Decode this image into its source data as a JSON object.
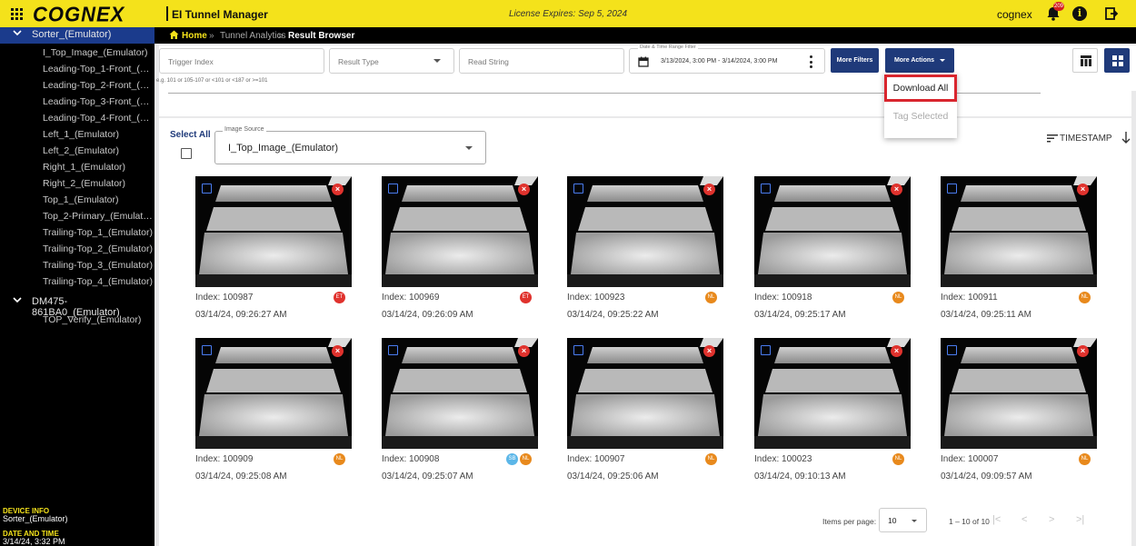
{
  "topbar": {
    "logo": "COGNEX",
    "product": "EI Tunnel Manager",
    "license": "License Expires: Sep 5, 2024",
    "user": "cognex",
    "notif_count": "209",
    "info_glyph": "i",
    "colors": {
      "bar": "#f4e21b",
      "navy": "#1f3a7a",
      "danger": "#e0322d"
    }
  },
  "breadcrumb": {
    "home": "Home",
    "sep": "»",
    "middle": "Tunnel Analytics",
    "current": "Result Browser"
  },
  "sidebar": {
    "groups": [
      {
        "label": "Sorter_(Emulator)",
        "items": [
          "I_Top_Image_(Emulator)",
          "Leading-Top_1-Front_(Emul...",
          "Leading-Top_2-Front_(Emul...",
          "Leading-Top_3-Front_(Emul...",
          "Leading-Top_4-Front_(Emul...",
          "Left_1_(Emulator)",
          "Left_2_(Emulator)",
          "Right_1_(Emulator)",
          "Right_2_(Emulator)",
          "Top_1_(Emulator)",
          "Top_2-Primary_(Emulator)",
          "Trailing-Top_1_(Emulator)",
          "Trailing-Top_2_(Emulator)",
          "Trailing-Top_3_(Emulator)",
          "Trailing-Top_4_(Emulator)"
        ]
      },
      {
        "label": "DM475-861BA0_(Emulator)",
        "items": [
          "TOP_Verify_(Emulator)"
        ]
      }
    ],
    "device_info_label": "DEVICE INFO",
    "device_name": "Sorter_(Emulator)",
    "date_label": "DATE AND TIME",
    "date_value": "3/14/24, 3:32 PM"
  },
  "filters": {
    "trigger_placeholder": "Trigger Index",
    "trigger_hint": "e.g. 101 or 105-107 or <101 or <187 or >=101",
    "result_type_placeholder": "Result Type",
    "read_string_placeholder": "Read String",
    "date_legend": "Date & Time Range Filter",
    "date_range": "3/13/2024, 3:00 PM - 3/14/2024, 3:00 PM",
    "more_filters": "More Filters",
    "more_actions": "More Actions"
  },
  "menu": {
    "download_all": "Download All",
    "tag_selected": "Tag Selected"
  },
  "toolbar": {
    "select_all": "Select All",
    "image_source_legend": "Image Source",
    "image_source_value": "I_Top_Image_(Emulator)",
    "sort_label": "TIMESTAMP"
  },
  "cards": [
    {
      "index": "Index: 100987",
      "time": "03/14/24, 09:26:27 AM",
      "badges": [
        {
          "text": "ET",
          "color": "#e0322d"
        }
      ]
    },
    {
      "index": "Index: 100969",
      "time": "03/14/24, 09:26:09 AM",
      "badges": [
        {
          "text": "ET",
          "color": "#e0322d"
        }
      ]
    },
    {
      "index": "Index: 100923",
      "time": "03/14/24, 09:25:22 AM",
      "badges": [
        {
          "text": "NL",
          "color": "#e8891c"
        }
      ]
    },
    {
      "index": "Index: 100918",
      "time": "03/14/24, 09:25:17 AM",
      "badges": [
        {
          "text": "NL",
          "color": "#e8891c"
        }
      ]
    },
    {
      "index": "Index: 100911",
      "time": "03/14/24, 09:25:11 AM",
      "badges": [
        {
          "text": "NL",
          "color": "#e8891c"
        }
      ]
    },
    {
      "index": "Index: 100909",
      "time": "03/14/24, 09:25:08 AM",
      "badges": [
        {
          "text": "NL",
          "color": "#e8891c"
        }
      ]
    },
    {
      "index": "Index: 100908",
      "time": "03/14/24, 09:25:07 AM",
      "badges": [
        {
          "text": "SB",
          "color": "#5bb6e8"
        },
        {
          "text": "NL",
          "color": "#e8891c"
        }
      ]
    },
    {
      "index": "Index: 100907",
      "time": "03/14/24, 09:25:06 AM",
      "badges": [
        {
          "text": "NL",
          "color": "#e8891c"
        }
      ]
    },
    {
      "index": "Index: 100023",
      "time": "03/14/24, 09:10:13 AM",
      "badges": [
        {
          "text": "NL",
          "color": "#e8891c"
        }
      ]
    },
    {
      "index": "Index: 100007",
      "time": "03/14/24, 09:09:57 AM",
      "badges": [
        {
          "text": "NL",
          "color": "#e8891c"
        }
      ]
    }
  ],
  "pagination": {
    "items_per_page_label": "Items per page:",
    "items_per_page": "10",
    "range": "1 – 10 of 10"
  }
}
